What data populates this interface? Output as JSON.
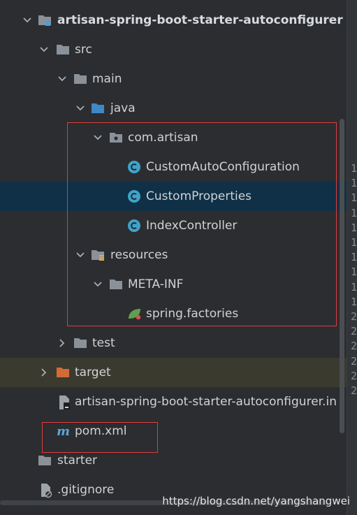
{
  "tree": {
    "root_label": "artisan-spring-boot-starter-autoconfigurer",
    "src_label": "src",
    "main_label": "main",
    "java_label": "java",
    "package_label": "com.artisan",
    "class1_label": "CustomAutoConfiguration",
    "class2_label": "CustomProperties",
    "class3_label": "IndexController",
    "resources_label": "resources",
    "metainf_label": "META-INF",
    "factories_label": "spring.factories",
    "test_label": "test",
    "target_label": "target",
    "iml_label": "artisan-spring-boot-starter-autoconfigurer.in",
    "pom_label": "pom.xml",
    "starter_label": "starter",
    "gitignore_label": ".gitignore"
  },
  "gutter_numbers": [
    "1",
    "1",
    "1",
    "1",
    "1",
    "1",
    "1",
    "1",
    "1",
    "1",
    "2",
    "2",
    "2",
    "2",
    "2",
    "2"
  ],
  "watermark": "https://blog.csdn.net/yangshangwei",
  "colors": {
    "background": "#2b2d30",
    "selection": "#0f3047",
    "excluded": "#3b3a2f",
    "highlight_box": "#e03c3c",
    "folder": "#8a9199",
    "source_folder": "#3f88c5",
    "class_icon": "#3fa3c9",
    "target_folder": "#d36b37"
  }
}
